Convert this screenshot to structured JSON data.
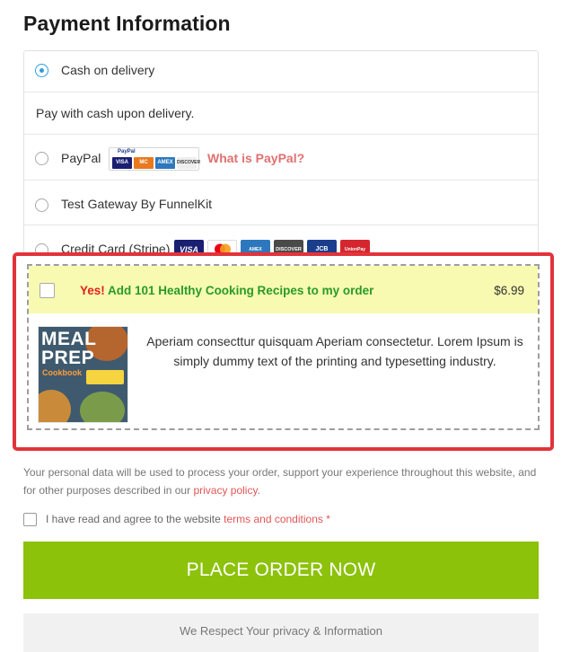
{
  "page_title": "Payment Information",
  "payment_methods": {
    "cod": {
      "label": "Cash on delivery",
      "description": "Pay with cash upon delivery.",
      "selected": true
    },
    "paypal": {
      "label": "PayPal",
      "logo_text": "PayPal",
      "mini_cards": [
        "VISA",
        "MC",
        "AMEX",
        "DISCOVER"
      ],
      "what_link": "What is PayPal?"
    },
    "test_gateway": {
      "label": "Test Gateway By FunnelKit"
    },
    "stripe": {
      "label": "Credit Card (Stripe)",
      "cards": [
        "VISA",
        "mastercard",
        "AMEX",
        "DISCOVER",
        "JCB",
        "UnionPay"
      ]
    }
  },
  "order_bump": {
    "yes": "Yes!",
    "title_rest": " Add 101 Healthy Cooking Recipes to my order",
    "price": "$6.99",
    "book_title_1": "MEAL",
    "book_title_2": "PREP",
    "book_subtitle": "Cookbook",
    "description": "Aperiam consecttur quisquam Aperiam consectetur. Lorem Ipsum is simply dummy text of the printing and typesetting industry."
  },
  "privacy": {
    "text": "Your personal data will be used to process your order, support your experience throughout this website, and for other purposes described in our ",
    "link": "privacy policy",
    "end": "."
  },
  "terms": {
    "text": "I have read and agree to the website ",
    "link": "terms and conditions",
    "required": "*"
  },
  "place_order": "PLACE ORDER NOW",
  "respect": "We Respect Your privacy & Information",
  "colors": {
    "accent_green": "#8cc20a",
    "highlight_red": "#e2333a",
    "bump_bg": "#f7fab0",
    "link": "#e05656"
  }
}
